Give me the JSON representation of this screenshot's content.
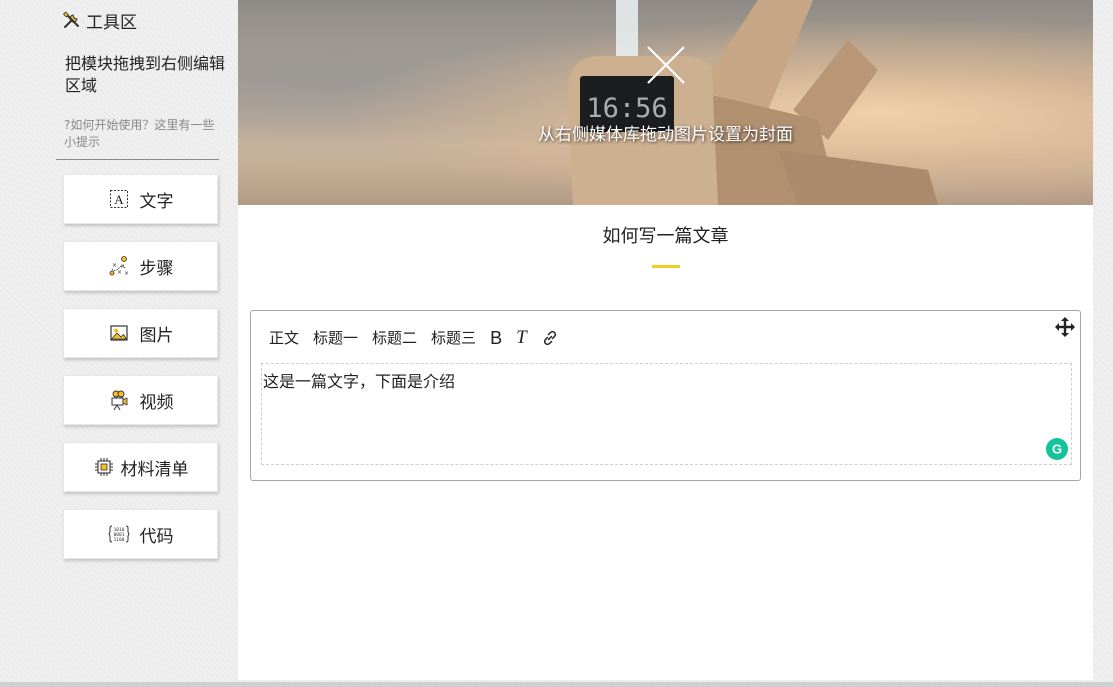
{
  "sidebar": {
    "title": "工具区",
    "title_icon": "tools-icon",
    "instruction": "把模块拖拽到右侧编辑区域",
    "hint": "?如何开始使用？这里有一些小提示",
    "modules": [
      {
        "label": "文字",
        "icon": "text-icon"
      },
      {
        "label": "步骤",
        "icon": "steps-icon"
      },
      {
        "label": "图片",
        "icon": "image-icon"
      },
      {
        "label": "视频",
        "icon": "video-icon"
      },
      {
        "label": "材料清单",
        "icon": "chip-icon"
      },
      {
        "label": "代码",
        "icon": "code-icon"
      }
    ]
  },
  "cover": {
    "clock_text": "16:56",
    "instruction": "从右侧媒体库拖动图片设置为封面",
    "close_icon": "close-icon"
  },
  "article": {
    "title": "如何写一篇文章",
    "accent_color": "#f2cf1e"
  },
  "text_block": {
    "toolbar": {
      "body": "正文",
      "h1": "标题一",
      "h2": "标题二",
      "h3": "标题三",
      "bold": "B",
      "italic": "T",
      "link_icon": "link-icon"
    },
    "content": "这是一篇文字，下面是介绍",
    "move_icon": "move-icon",
    "grammar_badge": "G",
    "grammar_color": "#15c39a"
  }
}
